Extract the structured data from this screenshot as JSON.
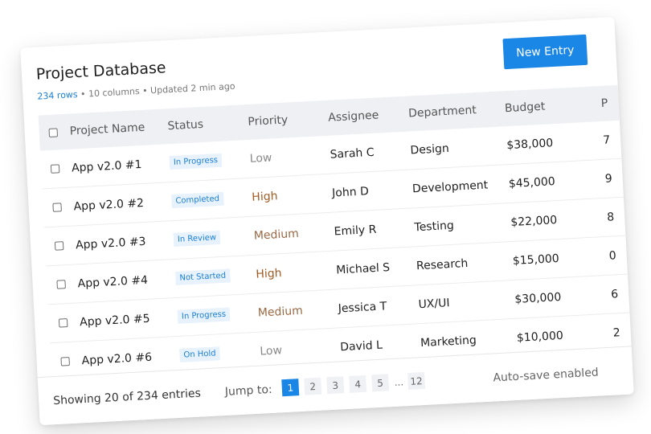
{
  "header": {
    "title": "Project Database",
    "rows": "234 rows",
    "meta_rest": " • 10 columns • Updated 2 min ago",
    "new_entry": "New Entry"
  },
  "table": {
    "columns": [
      "Project Name",
      "Status",
      "Priority",
      "Assignee",
      "Department",
      "Budget",
      "P"
    ],
    "rows": [
      {
        "name": "App v2.0 #1",
        "status": "In Progress",
        "priority": "Low",
        "priority_level": "low",
        "assignee": "Sarah C",
        "department": "Design",
        "budget": "$38,000",
        "extra": "7"
      },
      {
        "name": "App v2.0 #2",
        "status": "Completed",
        "priority": "High",
        "priority_level": "high",
        "assignee": "John D",
        "department": "Development",
        "budget": "$45,000",
        "extra": "9"
      },
      {
        "name": "App v2.0 #3",
        "status": "In Review",
        "priority": "Medium",
        "priority_level": "medium",
        "assignee": "Emily R",
        "department": "Testing",
        "budget": "$22,000",
        "extra": "8"
      },
      {
        "name": "App v2.0 #4",
        "status": "Not Started",
        "priority": "High",
        "priority_level": "high",
        "assignee": "Michael S",
        "department": "Research",
        "budget": "$15,000",
        "extra": "0"
      },
      {
        "name": "App v2.0 #5",
        "status": "In Progress",
        "priority": "Medium",
        "priority_level": "medium",
        "assignee": "Jessica T",
        "department": "UX/UI",
        "budget": "$30,000",
        "extra": "6"
      },
      {
        "name": "App v2.0 #6",
        "status": "On Hold",
        "priority": "Low",
        "priority_level": "low",
        "assignee": "David L",
        "department": "Marketing",
        "budget": "$10,000",
        "extra": "2"
      }
    ]
  },
  "footer": {
    "showing": "Showing 20 of 234 entries",
    "jump_label": "Jump to:",
    "pages": [
      "1",
      "2",
      "3",
      "4",
      "5"
    ],
    "ellipsis": "...",
    "last_page": "12",
    "current_page": "1",
    "autosave": "Auto-save enabled"
  },
  "colors": {
    "accent": "#1a87e6",
    "link": "#1a7fd6",
    "priority_high": "#a05a22",
    "priority_medium": "#9a6a45",
    "priority_low": "#888888"
  }
}
